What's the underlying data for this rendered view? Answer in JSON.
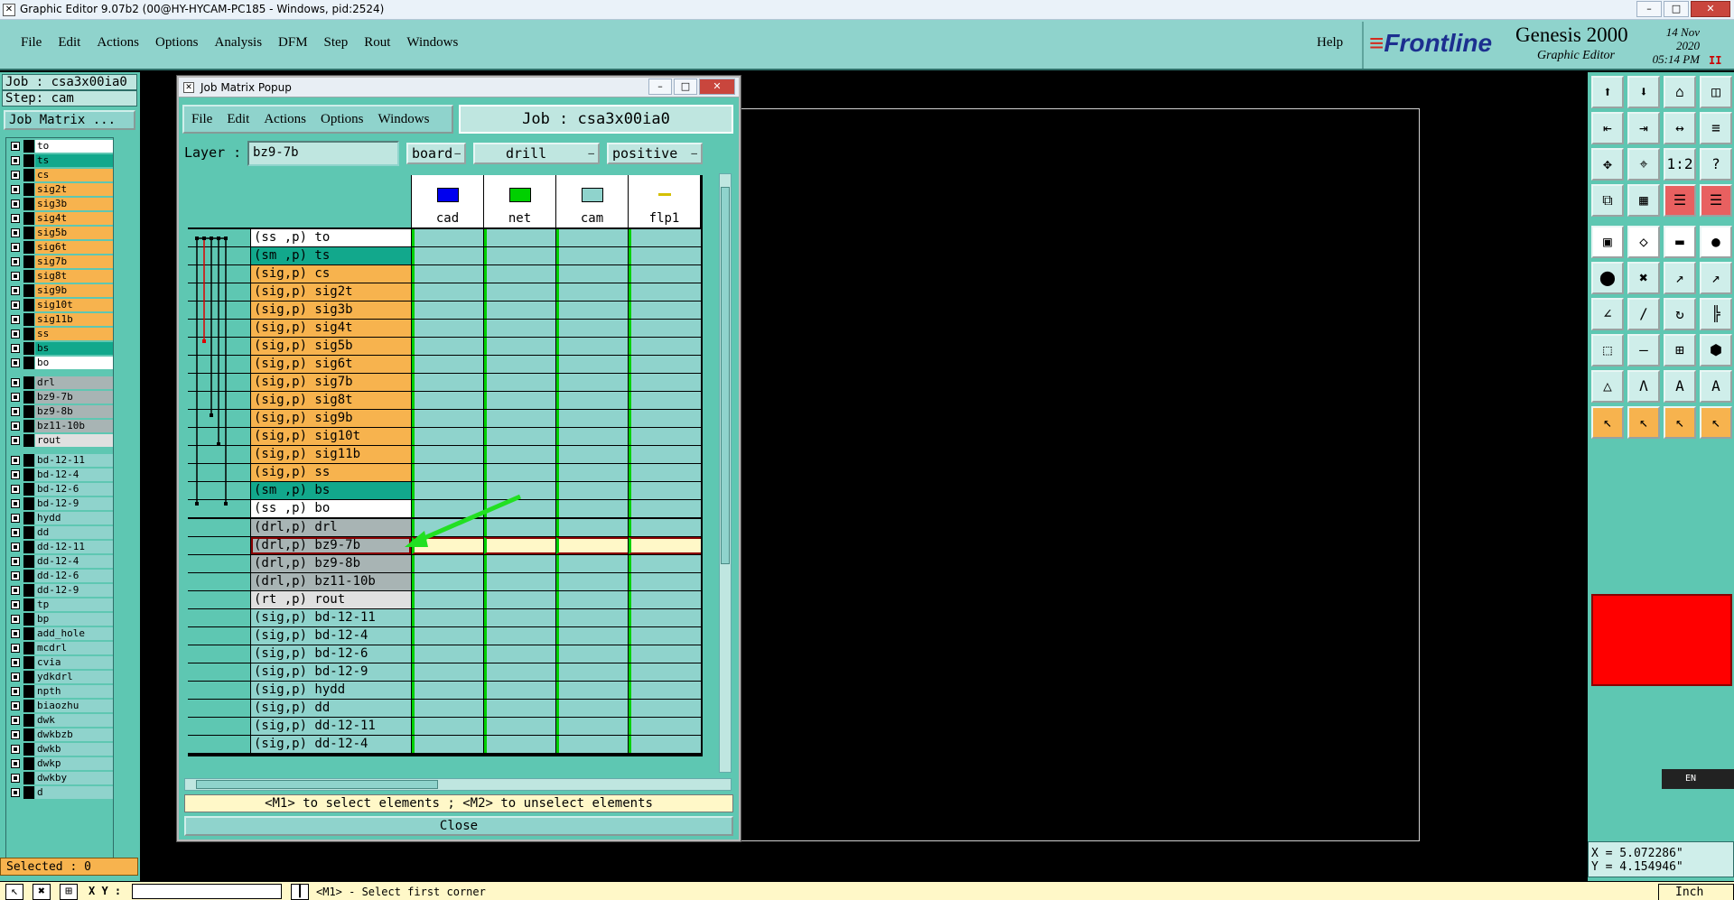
{
  "window": {
    "title": "Graphic Editor 9.07b2 (00@HY-HYCAM-PC185 - Windows, pid:2524)",
    "controls": [
      "–",
      "□",
      "✕"
    ]
  },
  "menubar": {
    "items": [
      "File",
      "Edit",
      "Actions",
      "Options",
      "Analysis",
      "DFM",
      "Step",
      "Rout",
      "Windows"
    ],
    "help": "Help"
  },
  "brand": {
    "logo": "Frontline",
    "product": "Genesis 2000",
    "subtitle": "Graphic Editor",
    "date": "14 Nov 2020",
    "time": "05:14 PM",
    "pause": "II"
  },
  "left": {
    "job": "Job : csa3x00ia0",
    "step": "Step: cam",
    "job_matrix_button": "Job Matrix ...",
    "selected": "Selected : 0",
    "layers": [
      {
        "name": "to",
        "color": "#ffffff"
      },
      {
        "name": "ts",
        "color": "#12a88c"
      },
      {
        "name": "cs",
        "color": "#f7b34e"
      },
      {
        "name": "sig2t",
        "color": "#f7b34e"
      },
      {
        "name": "sig3b",
        "color": "#f7b34e"
      },
      {
        "name": "sig4t",
        "color": "#f7b34e"
      },
      {
        "name": "sig5b",
        "color": "#f7b34e"
      },
      {
        "name": "sig6t",
        "color": "#f7b34e"
      },
      {
        "name": "sig7b",
        "color": "#f7b34e"
      },
      {
        "name": "sig8t",
        "color": "#f7b34e"
      },
      {
        "name": "sig9b",
        "color": "#f7b34e"
      },
      {
        "name": "sig10t",
        "color": "#f7b34e"
      },
      {
        "name": "sig11b",
        "color": "#f7b34e"
      },
      {
        "name": "ss",
        "color": "#f7b34e"
      },
      {
        "name": "bs",
        "color": "#12a88c"
      },
      {
        "name": "bo",
        "color": "#ffffff"
      },
      {
        "name": "drl",
        "color": "#a8b4b4"
      },
      {
        "name": "bz9-7b",
        "color": "#a8b4b4"
      },
      {
        "name": "bz9-8b",
        "color": "#a8b4b4"
      },
      {
        "name": "bz11-10b",
        "color": "#a8b4b4"
      },
      {
        "name": "rout",
        "color": "#e0e0e0"
      },
      {
        "name": "bd-12-11",
        "color": "#8fd3cc"
      },
      {
        "name": "bd-12-4",
        "color": "#8fd3cc"
      },
      {
        "name": "bd-12-6",
        "color": "#8fd3cc"
      },
      {
        "name": "bd-12-9",
        "color": "#8fd3cc"
      },
      {
        "name": "hydd",
        "color": "#8fd3cc"
      },
      {
        "name": "dd",
        "color": "#8fd3cc"
      },
      {
        "name": "dd-12-11",
        "color": "#8fd3cc"
      },
      {
        "name": "dd-12-4",
        "color": "#8fd3cc"
      },
      {
        "name": "dd-12-6",
        "color": "#8fd3cc"
      },
      {
        "name": "dd-12-9",
        "color": "#8fd3cc"
      },
      {
        "name": "tp",
        "color": "#8fd3cc"
      },
      {
        "name": "bp",
        "color": "#8fd3cc"
      },
      {
        "name": "add_hole",
        "color": "#8fd3cc"
      },
      {
        "name": "mcdrl",
        "color": "#8fd3cc"
      },
      {
        "name": "cvia",
        "color": "#8fd3cc"
      },
      {
        "name": "ydkdrl",
        "color": "#8fd3cc"
      },
      {
        "name": "npth",
        "color": "#8fd3cc"
      },
      {
        "name": "biaozhu",
        "color": "#8fd3cc"
      },
      {
        "name": "dwk",
        "color": "#8fd3cc"
      },
      {
        "name": "dwkbzb",
        "color": "#8fd3cc"
      },
      {
        "name": "dwkb",
        "color": "#8fd3cc"
      },
      {
        "name": "dwkp",
        "color": "#8fd3cc"
      },
      {
        "name": "dwkby",
        "color": "#8fd3cc"
      },
      {
        "name": "d",
        "color": "#8fd3cc"
      }
    ]
  },
  "popup": {
    "title": "Job Matrix Popup",
    "menus": [
      "File",
      "Edit",
      "Actions",
      "Options",
      "Windows"
    ],
    "job": "Job : csa3x00ia0",
    "layer_label": "Layer :",
    "layer_value": "bz9-7b",
    "context": "board",
    "type": "drill",
    "polarity": "positive",
    "hint": "<M1> to select elements ; <M2> to unselect elements",
    "close": "Close",
    "columns": [
      {
        "name": "cad",
        "color": "#0000ee"
      },
      {
        "name": "net",
        "color": "#00d000"
      },
      {
        "name": "cam",
        "color": "#8fd3cc"
      },
      {
        "name": "flp1",
        "color": "#d4c000"
      }
    ],
    "rows": [
      {
        "label": "(ss ,p) to",
        "color": "#ffffff"
      },
      {
        "label": "(sm ,p) ts",
        "color": "#12a88c"
      },
      {
        "label": "(sig,p) cs",
        "color": "#f7b34e"
      },
      {
        "label": "(sig,p) sig2t",
        "color": "#f7b34e"
      },
      {
        "label": "(sig,p) sig3b",
        "color": "#f7b34e"
      },
      {
        "label": "(sig,p) sig4t",
        "color": "#f7b34e"
      },
      {
        "label": "(sig,p) sig5b",
        "color": "#f7b34e"
      },
      {
        "label": "(sig,p) sig6t",
        "color": "#f7b34e"
      },
      {
        "label": "(sig,p) sig7b",
        "color": "#f7b34e"
      },
      {
        "label": "(sig,p) sig8t",
        "color": "#f7b34e"
      },
      {
        "label": "(sig,p) sig9b",
        "color": "#f7b34e"
      },
      {
        "label": "(sig,p) sig10t",
        "color": "#f7b34e"
      },
      {
        "label": "(sig,p) sig11b",
        "color": "#f7b34e"
      },
      {
        "label": "(sig,p) ss",
        "color": "#f7b34e"
      },
      {
        "label": "(sm ,p) bs",
        "color": "#12a88c"
      },
      {
        "label": "(ss ,p) bo",
        "color": "#ffffff"
      },
      {
        "label": "(drl,p) drl",
        "color": "#a8b4b4"
      },
      {
        "label": "(drl,p) bz9-7b",
        "color": "#a8b4b4",
        "selected": true
      },
      {
        "label": "(drl,p) bz9-8b",
        "color": "#a8b4b4"
      },
      {
        "label": "(drl,p) bz11-10b",
        "color": "#a8b4b4"
      },
      {
        "label": "(rt ,p) rout",
        "color": "#e0e0e0"
      },
      {
        "label": "(sig,p) bd-12-11",
        "color": "#8fd3cc"
      },
      {
        "label": "(sig,p) bd-12-4",
        "color": "#8fd3cc"
      },
      {
        "label": "(sig,p) bd-12-6",
        "color": "#8fd3cc"
      },
      {
        "label": "(sig,p) bd-12-9",
        "color": "#8fd3cc"
      },
      {
        "label": "(sig,p) hydd",
        "color": "#8fd3cc"
      },
      {
        "label": "(sig,p) dd",
        "color": "#8fd3cc"
      },
      {
        "label": "(sig,p) dd-12-11",
        "color": "#8fd3cc"
      },
      {
        "label": "(sig,p) dd-12-4",
        "color": "#8fd3cc"
      }
    ]
  },
  "right": {
    "coord_x": "X = 5.072286\"",
    "coord_y": "Y = 4.154946\"",
    "lang": "EN",
    "tools": [
      {
        "icon": "⬆",
        "style": ""
      },
      {
        "icon": "⬇",
        "style": ""
      },
      {
        "icon": "⌂",
        "style": ""
      },
      {
        "icon": "◫",
        "style": ""
      },
      {
        "icon": "⇤",
        "style": ""
      },
      {
        "icon": "⇥",
        "style": ""
      },
      {
        "icon": "↔",
        "style": ""
      },
      {
        "icon": "≡",
        "style": ""
      },
      {
        "icon": "✥",
        "style": ""
      },
      {
        "icon": "⌖",
        "style": ""
      },
      {
        "icon": "1:2",
        "style": ""
      },
      {
        "icon": "?",
        "style": ""
      },
      {
        "icon": "⧉",
        "style": ""
      },
      {
        "icon": "▦",
        "style": ""
      },
      {
        "icon": "☰",
        "style": "red"
      },
      {
        "icon": "☰",
        "style": "red"
      },
      {
        "icon": "▣",
        "style": "blk"
      },
      {
        "icon": "◇",
        "style": "blk"
      },
      {
        "icon": "▬",
        "style": "blk"
      },
      {
        "icon": "●",
        "style": "blk"
      },
      {
        "icon": "⬤",
        "style": ""
      },
      {
        "icon": "✖",
        "style": ""
      },
      {
        "icon": "↗",
        "style": ""
      },
      {
        "icon": "↗",
        "style": ""
      },
      {
        "icon": "∠",
        "style": ""
      },
      {
        "icon": "∕",
        "style": ""
      },
      {
        "icon": "↻",
        "style": ""
      },
      {
        "icon": "╠",
        "style": ""
      },
      {
        "icon": "⬚",
        "style": ""
      },
      {
        "icon": "—",
        "style": ""
      },
      {
        "icon": "⊞",
        "style": ""
      },
      {
        "icon": "⬢",
        "style": ""
      },
      {
        "icon": "△",
        "style": ""
      },
      {
        "icon": "Λ",
        "style": ""
      },
      {
        "icon": "A",
        "style": ""
      },
      {
        "icon": "A",
        "style": ""
      },
      {
        "icon": "↖",
        "style": "org"
      },
      {
        "icon": "↖",
        "style": "org"
      },
      {
        "icon": "↖",
        "style": "org"
      },
      {
        "icon": "↖",
        "style": "org"
      }
    ]
  },
  "status": {
    "xy_label": "X Y :",
    "message": "<M1> - Select first corner",
    "unit": "Inch"
  }
}
